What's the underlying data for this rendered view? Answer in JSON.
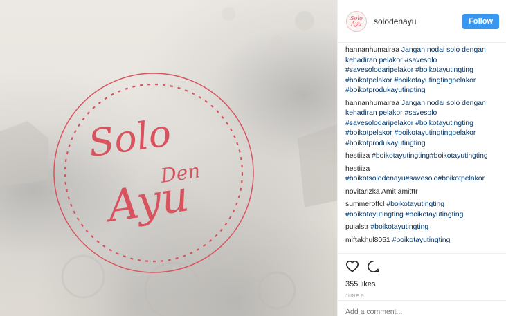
{
  "post": {
    "logo_lines": [
      "Solo",
      "Den",
      "Ayu"
    ]
  },
  "header": {
    "avatar_text_1": "Solo",
    "avatar_text_2": "Ayu",
    "username": "solodenayu",
    "follow_label": "Follow"
  },
  "comments": [
    {
      "user": "hannanhumairaa",
      "text": "Jangan nodai solo dengan kehadiran pelakor #savesolo #savesolodaripelakor #boikotayutingting #boikotpelakor #boikotayutingtingpelakor #boikotprodukayutingting"
    },
    {
      "user": "hannanhumairaa",
      "text": "Jangan nodai solo dengan kehadiran pelakor #savesolo #savesolodaripelakor #boikotayutingting #boikotpelakor #boikotayutingtingpelakor #boikotprodukayutingting"
    },
    {
      "user": "hestiiza",
      "text": "#boikotayutingting#boikotayutingting"
    },
    {
      "user": "hestiiza",
      "text": "#boikotsolodenayu#savesolo#boikotpelakor"
    },
    {
      "user": "novitarizka",
      "text": "Amit amitttr"
    },
    {
      "user": "summeroffcl",
      "text": "#boikotayutingting #boikotayutingting #boikotayutingting"
    },
    {
      "user": "pujalstr",
      "text": "#boikotayutingting"
    },
    {
      "user": "miftakhul8051",
      "text": "#boikotayutingting"
    }
  ],
  "actions": {
    "like_icon": "heart-icon",
    "comment_icon": "comment-icon",
    "likes": "355 likes",
    "date": "JUNE 9"
  },
  "add_comment": {
    "placeholder": "Add a comment..."
  },
  "colors": {
    "brand_red": "#d9535f",
    "follow_blue": "#3897f0",
    "hashtag": "#003569"
  }
}
